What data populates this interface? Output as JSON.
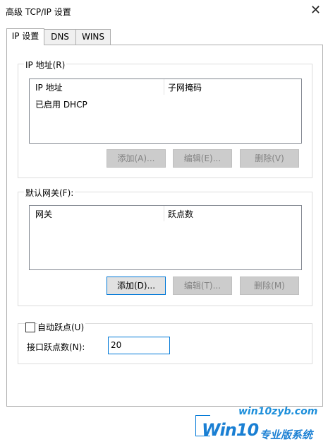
{
  "window": {
    "title": "高级 TCP/IP 设置",
    "close": "✕"
  },
  "tabs": [
    {
      "label": "IP 设置"
    },
    {
      "label": "DNS"
    },
    {
      "label": "WINS"
    }
  ],
  "ip_group": {
    "legend": "IP 地址(R)",
    "columns": [
      "IP 地址",
      "子网掩码"
    ],
    "rows": [
      {
        "ip": "已启用 DHCP",
        "mask": ""
      }
    ],
    "buttons": {
      "add": "添加(A)...",
      "edit": "编辑(E)...",
      "delete": "删除(V)"
    }
  },
  "gateway_group": {
    "legend": "默认网关(F):",
    "columns": [
      "网关",
      "跃点数"
    ],
    "buttons": {
      "add": "添加(D)...",
      "edit": "编辑(T)...",
      "delete": "删除(M)"
    }
  },
  "metric_group": {
    "auto_metric_label": "自动跃点(U)",
    "auto_metric_checked": false,
    "interface_metric_label": "接口跃点数(N):",
    "interface_metric_value": "20"
  },
  "watermark": {
    "top": "win10zyb.com",
    "logo": "Win10",
    "sub": "专业版系统"
  }
}
